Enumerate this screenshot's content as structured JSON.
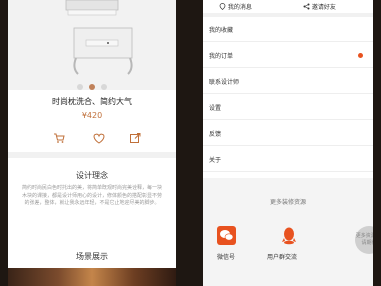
{
  "product": {
    "title": "时尚枕洗合、简约大气",
    "price": "¥420",
    "carousel": {
      "count": 3,
      "active_index": 1
    },
    "icons": [
      "cart-icon",
      "heart-icon",
      "share-icon"
    ]
  },
  "concept": {
    "title": "设计理念",
    "text": "简约时尚民白色时托出的美，将简单既观时尚完美诠释，每一块木块的课接，都是设计师用心的设计，修体颜色的搭配彰显不劳的张差，整体，就让我永远年轻，不是它止地迎尽美的脚步。"
  },
  "scene": {
    "title": "场景展示"
  },
  "account": {
    "links": [
      "我的消息",
      "邀请好友"
    ],
    "menu": [
      {
        "label": "我的收藏",
        "badge": false
      },
      {
        "label": "我的订单",
        "badge": true
      },
      {
        "label": "联系设计师",
        "badge": false
      },
      {
        "label": "设置",
        "badge": false
      },
      {
        "label": "反馈",
        "badge": false
      },
      {
        "label": "关于",
        "badge": false
      }
    ],
    "more_resources": "更多装修资源",
    "bottom": [
      {
        "label": "微信号",
        "icon": "wechat-icon"
      },
      {
        "label": "用户群交流",
        "icon": "qq-icon"
      }
    ],
    "more_circle": "更多资源 敬请期待"
  },
  "colors": {
    "accent": "#c0703a",
    "orange": "#e8521f",
    "background": "#1e1712"
  }
}
